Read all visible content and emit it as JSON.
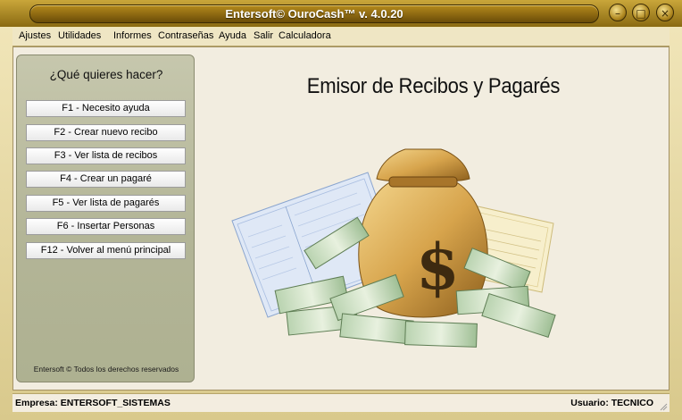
{
  "window": {
    "title": "Entersoft© OuroCash™ v. 4.0.20",
    "colors": {
      "frame": "#c9a63a",
      "pill": "#8a6a12",
      "panel": "#b3b597"
    }
  },
  "menu": {
    "items": [
      "Ajustes",
      "Utilidades",
      "Informes",
      "Contraseñas",
      "Ayuda",
      "Salir",
      "Calculadora"
    ]
  },
  "sidebar": {
    "title": "¿Qué quieres hacer?",
    "buttons": [
      "F1 - Necesito ayuda",
      "F2 - Crear nuevo recibo",
      "F3 - Ver lista de recibos",
      "F4 - Crear un pagaré",
      "F5 - Ver lista de pagarés",
      "F6 - Insertar Personas",
      "F12 - Volver al menú principal"
    ],
    "footer": "Entersoft © Todos los derechos reservados"
  },
  "main": {
    "heading": "Emisor de Recibos y Pagarés"
  },
  "status": {
    "empresa": "Empresa: ENTERSOFT_SISTEMAS",
    "usuario": "Usuario: TECNICO"
  }
}
